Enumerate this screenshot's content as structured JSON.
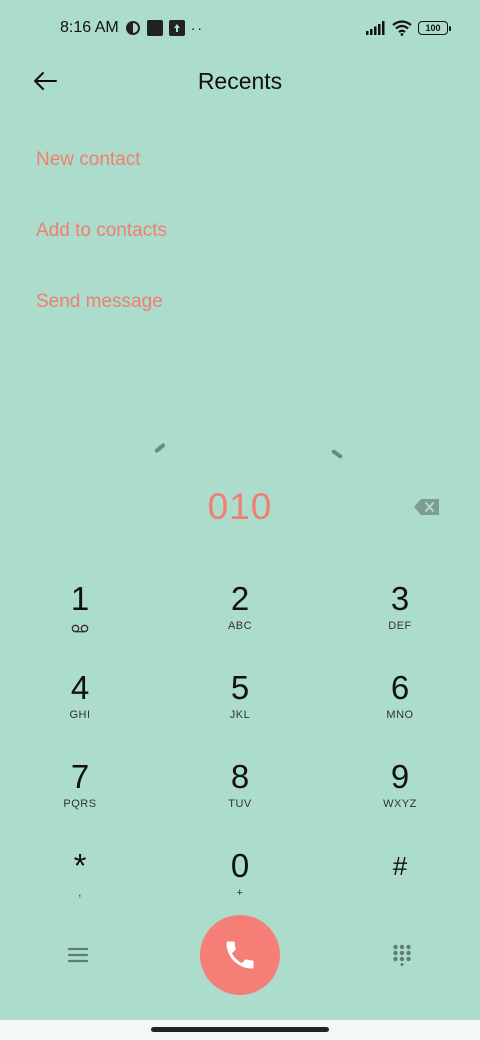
{
  "status_bar": {
    "time": "8:16 AM",
    "battery": "100",
    "dots": "··"
  },
  "header": {
    "title": "Recents",
    "back_icon": "arrow-left-icon"
  },
  "actions": [
    {
      "label": "New contact"
    },
    {
      "label": "Add to contacts"
    },
    {
      "label": "Send message"
    }
  ],
  "dialer": {
    "number": "010",
    "keys": [
      {
        "digit": "1",
        "letters": ""
      },
      {
        "digit": "2",
        "letters": "ABC"
      },
      {
        "digit": "3",
        "letters": "DEF"
      },
      {
        "digit": "4",
        "letters": "GHI"
      },
      {
        "digit": "5",
        "letters": "JKL"
      },
      {
        "digit": "6",
        "letters": "MNO"
      },
      {
        "digit": "7",
        "letters": "PQRS"
      },
      {
        "digit": "8",
        "letters": "TUV"
      },
      {
        "digit": "9",
        "letters": "WXYZ"
      },
      {
        "digit": "*",
        "letters": ","
      },
      {
        "digit": "0",
        "letters": "+"
      },
      {
        "digit": "#",
        "letters": ""
      }
    ]
  },
  "colors": {
    "background": "#abdccc",
    "accent": "#f07f72",
    "call_button": "#f57e77"
  }
}
